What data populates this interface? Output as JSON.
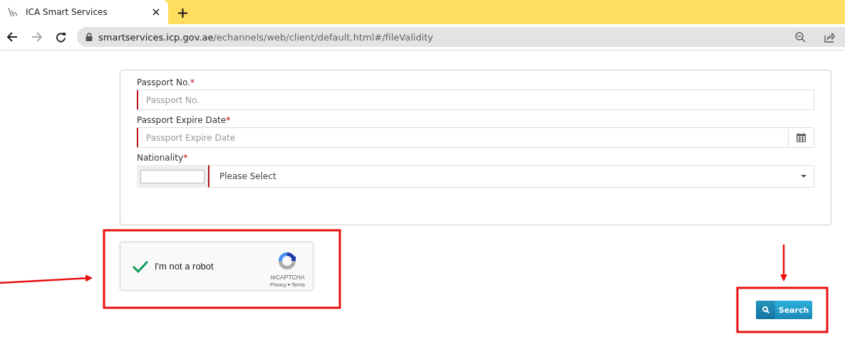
{
  "browser": {
    "tab": {
      "title": "ICA Smart Services"
    },
    "nav": {
      "back_disabled": false,
      "forward_disabled": true
    },
    "url": {
      "host": "smartservices.icp.gov.ae",
      "path": "/echannels/web/client/default.html#/fileValidity"
    }
  },
  "form": {
    "fields": [
      {
        "kind": "text",
        "label": "Passport No.",
        "asterisk": "*",
        "required": true,
        "placeholder": "Passport No."
      },
      {
        "kind": "date",
        "label": "Passport Expire Date",
        "asterisk": "*",
        "required": true,
        "placeholder": "Passport Expire Date"
      },
      {
        "kind": "select",
        "label": "Nationality",
        "asterisk": "*",
        "required": true,
        "value": "Please Select"
      }
    ]
  },
  "captcha": {
    "checked": true,
    "label": "I'm not a robot",
    "brand": "reCAPTCHA",
    "links": [
      "Privacy",
      "Terms"
    ]
  },
  "search_button": {
    "label": "Search"
  }
}
